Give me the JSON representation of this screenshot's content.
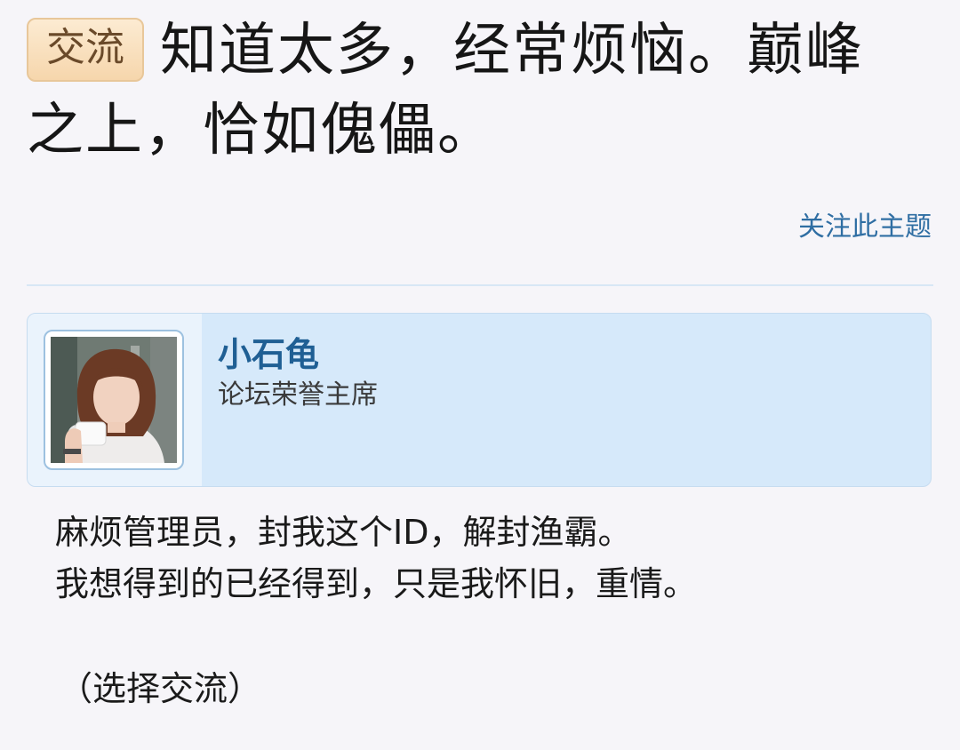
{
  "thread": {
    "tag": "交流",
    "title": "知道太多，经常烦恼。巅峰之上，恰如傀儡。",
    "follow_link": "关注此主题"
  },
  "author": {
    "name": "小石龟",
    "rank": "论坛荣誉主席",
    "avatar_icon": "user-photo-avatar"
  },
  "post": {
    "lines": [
      "麻烦管理员，封我这个ID，解封渔霸。",
      "我想得到的已经得到，只是我怀旧，重情。"
    ],
    "footnote": "（选择交流）"
  },
  "colors": {
    "background": "#f6f5f9",
    "link": "#2f6ea3",
    "author_card": "#d6e9fa",
    "author_name": "#1f5f94",
    "tag_bg": "#f6d6ac"
  }
}
